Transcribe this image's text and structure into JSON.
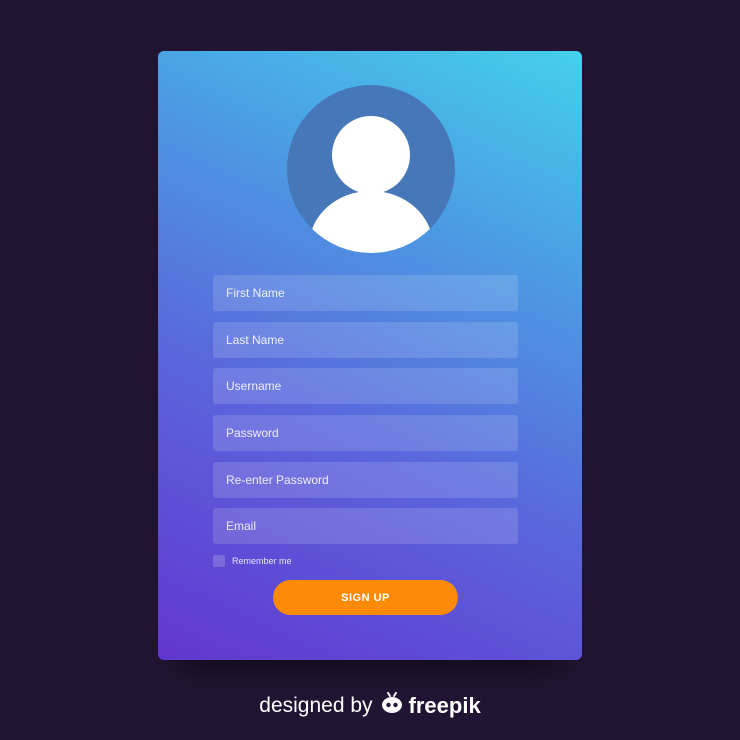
{
  "colors": {
    "background": "#221534",
    "accent": "#fb8a08",
    "avatar": "#4677b8"
  },
  "avatar": {
    "icon": "user-avatar-icon"
  },
  "form": {
    "first_name_placeholder": "First Name",
    "last_name_placeholder": "Last Name",
    "username_placeholder": "Username",
    "password_placeholder": "Password",
    "reenter_password_placeholder": "Re-enter Password",
    "email_placeholder": "Email",
    "remember_label": "Remember me",
    "signup_label": "SIGN UP"
  },
  "credit": {
    "prefix": "designed by",
    "brand": "freepik",
    "logo_icon": "freepik-logo-icon"
  }
}
